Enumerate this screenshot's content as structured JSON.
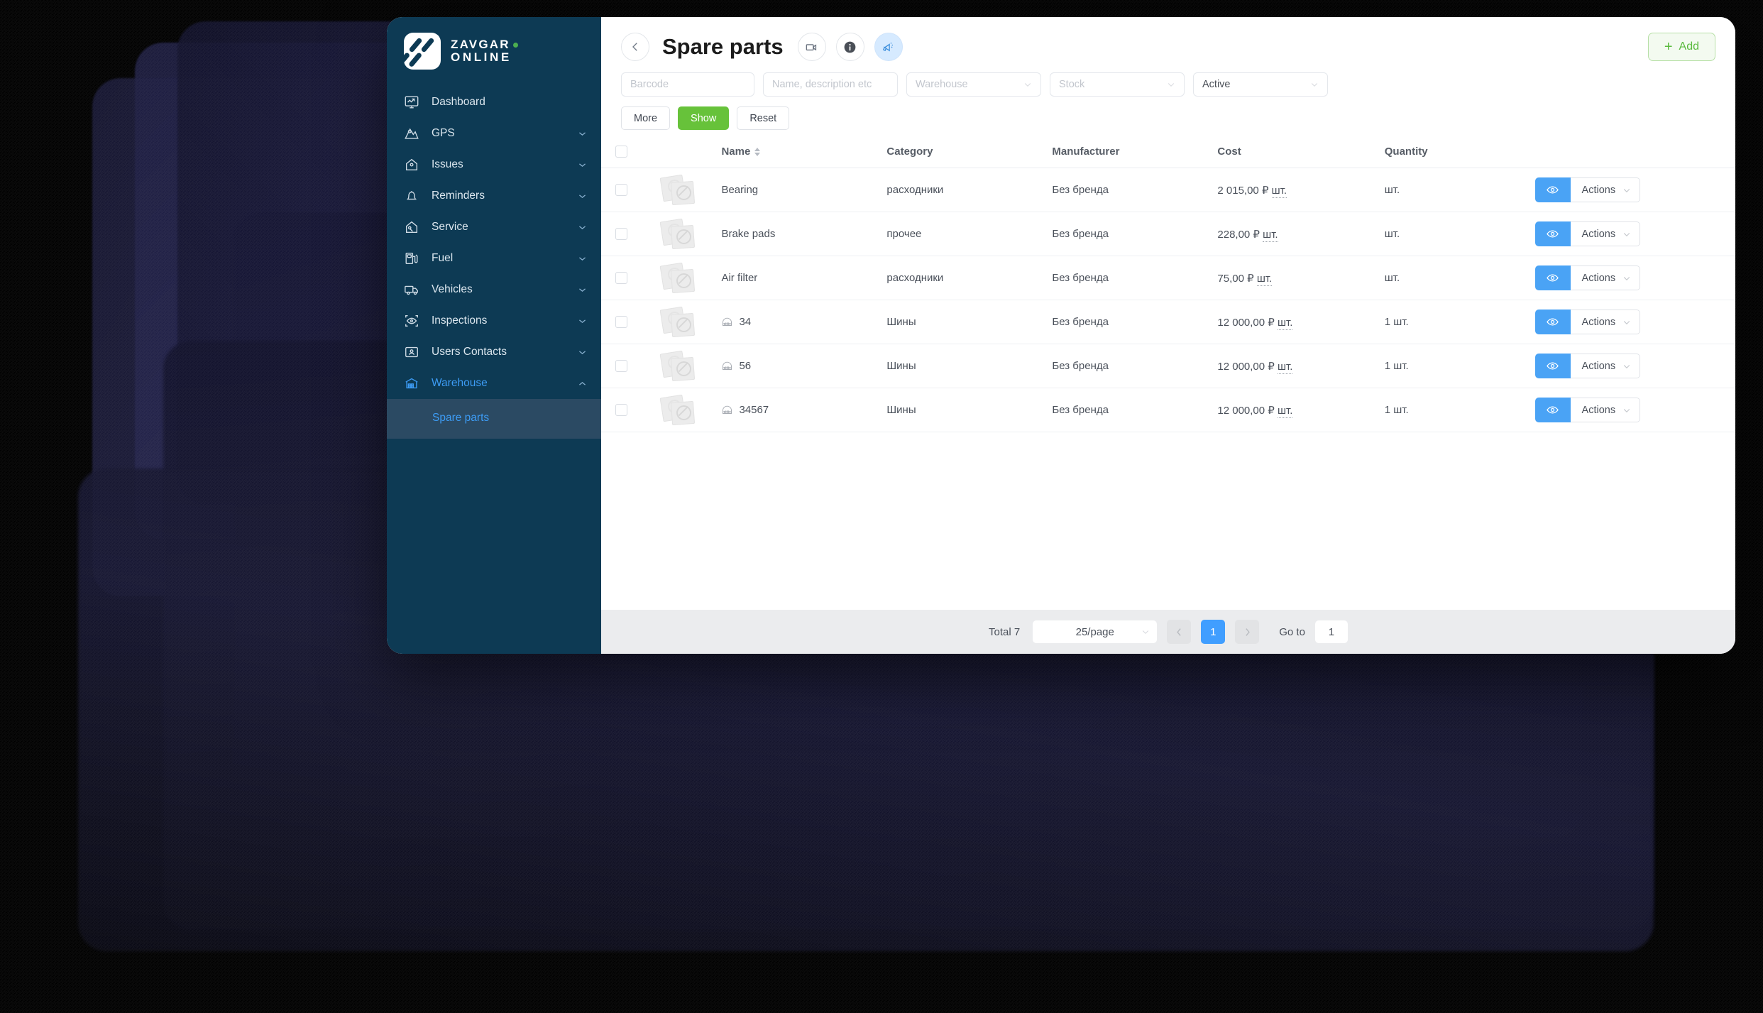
{
  "brand": {
    "line1": "ZAVGAR",
    "line2": "ONLINE",
    "dot_color": "#4caf50"
  },
  "sidebar": {
    "items": [
      {
        "label": "Dashboard",
        "icon": "dashboard-icon",
        "expandable": false,
        "active": false
      },
      {
        "label": "GPS",
        "icon": "gps-icon",
        "expandable": true,
        "active": false
      },
      {
        "label": "Issues",
        "icon": "issues-icon",
        "expandable": true,
        "active": false
      },
      {
        "label": "Reminders",
        "icon": "bell-icon",
        "expandable": true,
        "active": false
      },
      {
        "label": "Service",
        "icon": "service-icon",
        "expandable": true,
        "active": false
      },
      {
        "label": "Fuel",
        "icon": "fuel-icon",
        "expandable": true,
        "active": false
      },
      {
        "label": "Vehicles",
        "icon": "truck-icon",
        "expandable": true,
        "active": false
      },
      {
        "label": "Inspections",
        "icon": "eye-scan-icon",
        "expandable": true,
        "active": false
      },
      {
        "label": "Users Contacts",
        "icon": "user-card-icon",
        "expandable": true,
        "active": false
      },
      {
        "label": "Warehouse",
        "icon": "warehouse-icon",
        "expandable": true,
        "active": true
      }
    ],
    "submenu": [
      {
        "label": "Spare parts",
        "active": true
      }
    ]
  },
  "header": {
    "back_icon": "arrow-left-icon",
    "title": "Spare parts",
    "video_icon": "video-camera-icon",
    "info_icon": "info-icon",
    "announce_icon": "megaphone-icon",
    "add_label": "Add",
    "add_icon": "plus-icon",
    "add_color": "#5aba3e"
  },
  "filters": {
    "barcode_placeholder": "Barcode",
    "barcode_value": "",
    "name_placeholder": "Name, description etc",
    "name_value": "",
    "warehouse_placeholder": "Warehouse",
    "warehouse_value": "",
    "stock_placeholder": "Stock",
    "stock_value": "",
    "status_value": "Active",
    "buttons": {
      "more": "More",
      "show": "Show",
      "reset": "Reset",
      "show_color": "#67c23a"
    }
  },
  "table": {
    "columns": {
      "name": "Name",
      "category": "Category",
      "manufacturer": "Manufacturer",
      "cost": "Cost",
      "quantity": "Quantity"
    },
    "sort_icon": "sort-arrows-icon",
    "eye_icon": "eye-icon",
    "actions_label": "Actions",
    "actions_caret_icon": "chevron-down-icon",
    "accent_color": "#4aa3f5",
    "rows": [
      {
        "name": "Bearing",
        "has_tire_icon": false,
        "category": "расходники",
        "manufacturer": "Без бренда",
        "cost": "2 015,00 ₽",
        "cost_unit": "шт.",
        "quantity": "шт."
      },
      {
        "name": "Brake pads",
        "has_tire_icon": false,
        "category": "прочее",
        "manufacturer": "Без бренда",
        "cost": "228,00 ₽",
        "cost_unit": "шт.",
        "quantity": "шт."
      },
      {
        "name": "Air filter",
        "has_tire_icon": false,
        "category": "расходники",
        "manufacturer": "Без бренда",
        "cost": "75,00 ₽",
        "cost_unit": "шт.",
        "quantity": "шт."
      },
      {
        "name": "34",
        "has_tire_icon": true,
        "category": "Шины",
        "manufacturer": "Без бренда",
        "cost": "12 000,00 ₽",
        "cost_unit": "шт.",
        "quantity": "1 шт."
      },
      {
        "name": "56",
        "has_tire_icon": true,
        "category": "Шины",
        "manufacturer": "Без бренда",
        "cost": "12 000,00 ₽",
        "cost_unit": "шт.",
        "quantity": "1 шт."
      },
      {
        "name": "34567",
        "has_tire_icon": true,
        "category": "Шины",
        "manufacturer": "Без бренда",
        "cost": "12 000,00 ₽",
        "cost_unit": "шт.",
        "quantity": "1 шт."
      }
    ]
  },
  "pagination": {
    "total_label": "Total 7",
    "page_size": "25/page",
    "prev_icon": "chevron-left-icon",
    "next_icon": "chevron-right-icon",
    "current_page": "1",
    "goto_label": "Go to",
    "goto_value": "1",
    "active_color": "#409eff"
  }
}
